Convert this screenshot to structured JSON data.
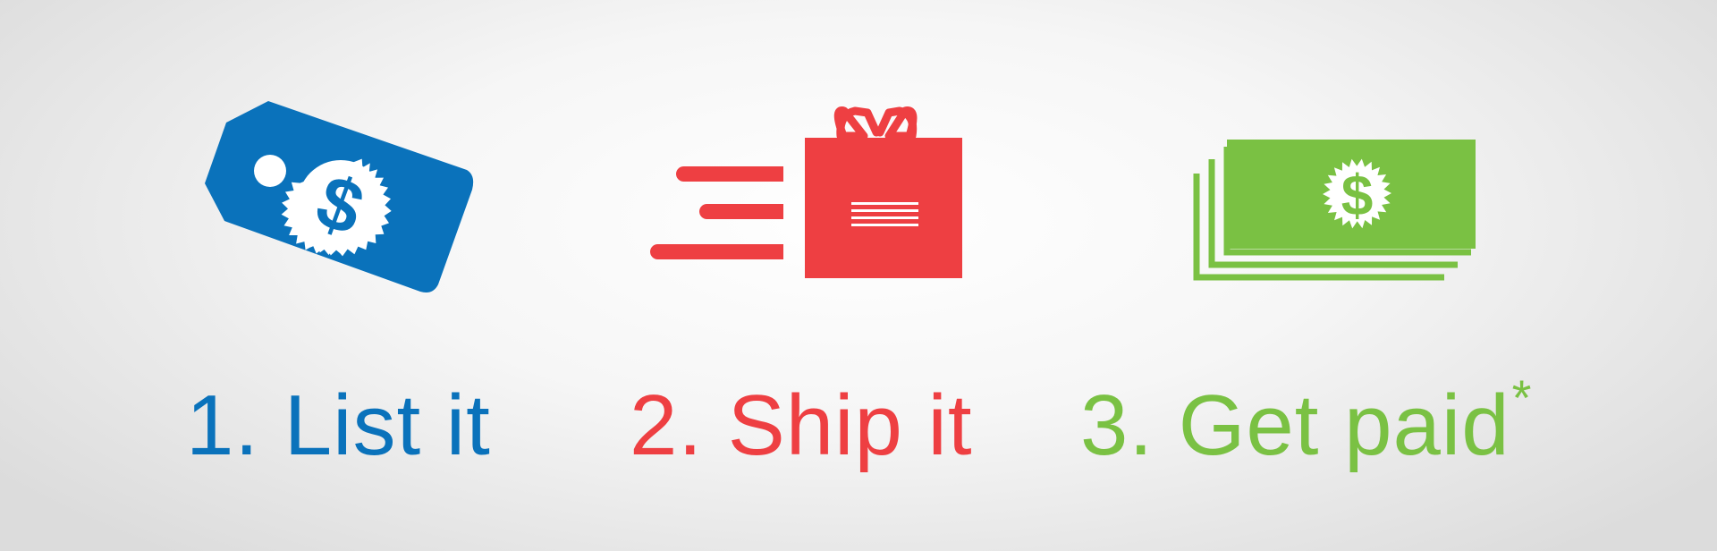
{
  "colors": {
    "blue": "#0a72bb",
    "red": "#ee3f42",
    "green": "#7ac143"
  },
  "steps": [
    {
      "label": "1. List it",
      "icon": "price-tag-dollar-icon",
      "color": "#0a72bb"
    },
    {
      "label": "2. Ship it",
      "icon": "fast-shipping-package-icon",
      "color": "#ee3f42"
    },
    {
      "label": "3. Get paid",
      "footnote_marker": "*",
      "icon": "dollar-bills-icon",
      "color": "#7ac143"
    }
  ]
}
